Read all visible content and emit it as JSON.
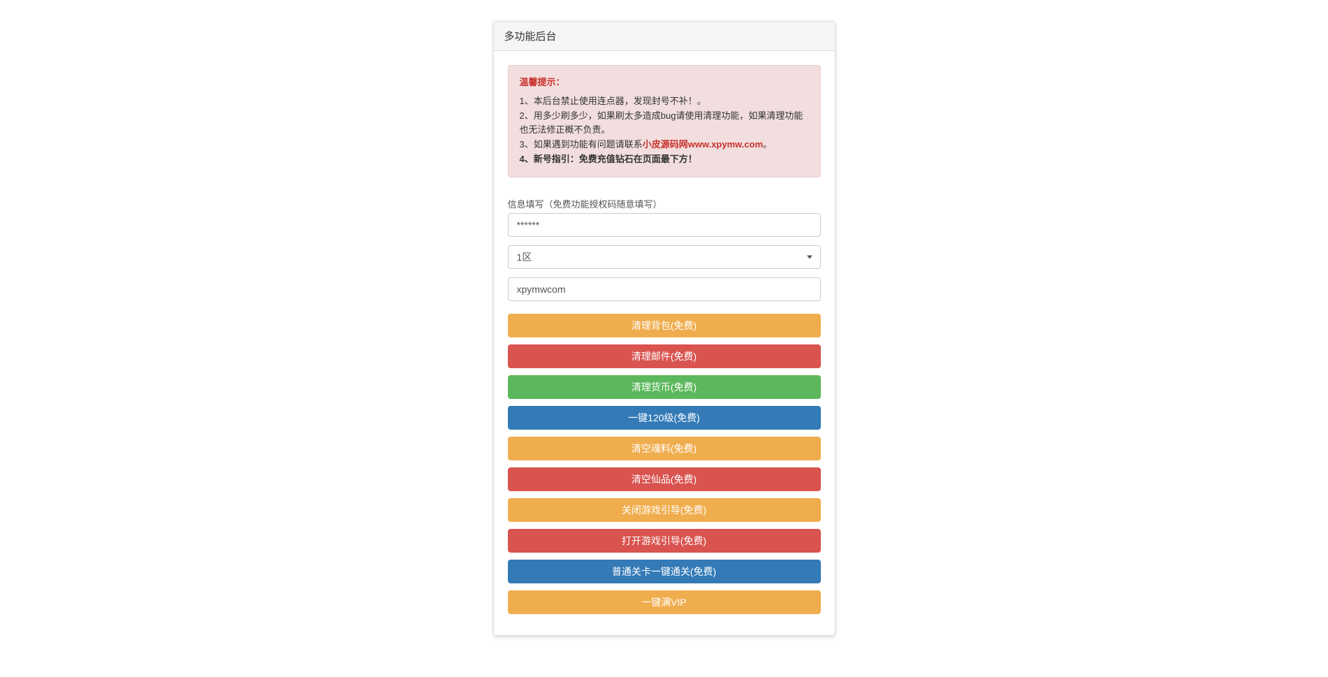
{
  "panel": {
    "title": "多功能后台"
  },
  "alert": {
    "title": "温馨提示：",
    "line1": "1、本后台禁止使用连点器，发现封号不补！。",
    "line2": "2、用多少刷多少，如果刷太多造成bug请使用清理功能，如果清理功能也无法修正概不负责。",
    "line3_prefix": "3、如果遇到功能有问题请联系",
    "line3_link": "小皮源码网www.xpymw.com",
    "line3_suffix": "。",
    "line4": "4、新号指引：免费充值钻石在页面最下方！"
  },
  "form": {
    "label": "信息填写（免费功能授权码随意填写）",
    "auth_code_value": "******",
    "region_selected": "1区",
    "username_value": "xpymwcom"
  },
  "buttons": [
    {
      "label": "清理背包(免费)",
      "style": "warning"
    },
    {
      "label": "清理邮件(免费)",
      "style": "danger"
    },
    {
      "label": "清理货币(免费)",
      "style": "success"
    },
    {
      "label": "一键120级(免费)",
      "style": "primary"
    },
    {
      "label": "清空魂料(免费)",
      "style": "warning"
    },
    {
      "label": "清空仙品(免费)",
      "style": "danger"
    },
    {
      "label": "关闭游戏引导(免费)",
      "style": "warning"
    },
    {
      "label": "打开游戏引导(免费)",
      "style": "danger"
    },
    {
      "label": "普通关卡一键通关(免费)",
      "style": "primary"
    },
    {
      "label": "一键满VIP",
      "style": "warning"
    }
  ]
}
